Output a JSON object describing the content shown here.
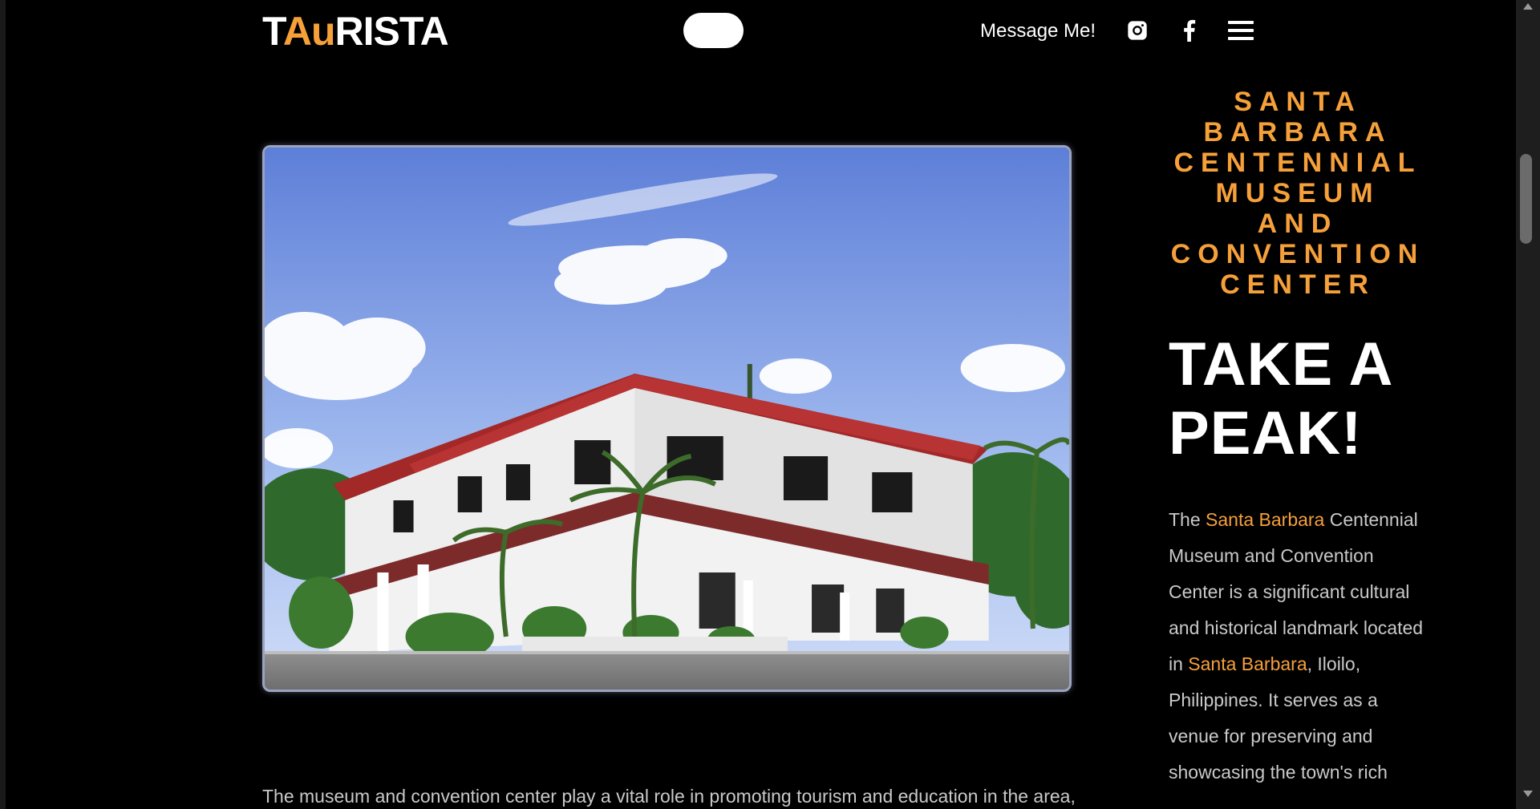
{
  "header": {
    "logo_prefix": "T",
    "logo_accent": "Au",
    "logo_suffix": "RISTA",
    "message_link": "Message Me!",
    "icons": [
      "instagram-icon",
      "facebook-icon",
      "menu-icon"
    ]
  },
  "colors": {
    "accent": "#f6a03a",
    "background": "#000000",
    "text": "#ffffff",
    "muted_text": "#c9c9c9"
  },
  "main": {
    "image_subject": "museum-building-photo",
    "body_text": "The museum and convention center play a vital role in promoting tourism and education in the area,"
  },
  "sidebar": {
    "place_title": "SANTA BARBARA CENTENNIAL MUSEUM AND CONVENTION CENTER",
    "cta": "TAKE A PEAK!",
    "desc_1": "The ",
    "desc_hl_1": "Santa Barbara",
    "desc_2": " Centennial Museum and Convention Center is a significant cultural and historical landmark located in ",
    "desc_hl_2": "Santa Barbara",
    "desc_3": ", Iloilo, Philippines. It serves as a venue for preserving and showcasing the town's rich"
  }
}
